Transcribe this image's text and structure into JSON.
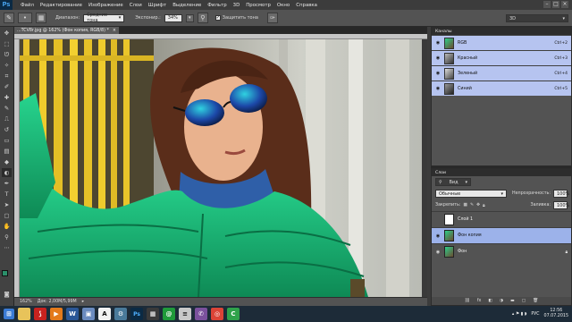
{
  "app": {
    "logo": "Ps"
  },
  "menu": [
    "Файл",
    "Редактирование",
    "Изображение",
    "Слои",
    "Шрифт",
    "Выделение",
    "Фильтр",
    "3D",
    "Просмотр",
    "Окно",
    "Справка"
  ],
  "options_bar": {
    "range_label": "Диапазон:",
    "range_value": "Средние тона",
    "exposure_label": "Экспонир.:",
    "exposure_value": "34%",
    "protect_label": "Защитить тона",
    "protect_checked": "✓",
    "workspace": "3D"
  },
  "document": {
    "tab_title": "...TCV8r.jpg @ 162% (Фон копия, RGB/8) *",
    "close": "×",
    "status_zoom": "162%",
    "status_doc": "Док: 2,00М/5,99М"
  },
  "colors": {
    "foreground": "#2b8f6a",
    "background": "#ffffff",
    "accent": "#b6c4f0"
  },
  "channels_panel": {
    "title": "Каналы",
    "channels": [
      {
        "name": "RGB",
        "shortcut": "Ctrl+2"
      },
      {
        "name": "Красный",
        "shortcut": "Ctrl+3"
      },
      {
        "name": "Зеленый",
        "shortcut": "Ctrl+4"
      },
      {
        "name": "Синий",
        "shortcut": "Ctrl+5"
      }
    ]
  },
  "layers_panel": {
    "title": "Слои",
    "kind_label": "Вид",
    "blend_mode": "Обычные",
    "opacity_label": "Непрозрачность:",
    "opacity_value": "100%",
    "lock_label": "Закрепить:",
    "fill_label": "Заливка:",
    "fill_value": "100%",
    "layers": [
      {
        "name": "Слой 1"
      },
      {
        "name": "Фон копия"
      },
      {
        "name": "Фон"
      }
    ]
  },
  "taskbar": {
    "language": "РУС",
    "time": "12:56",
    "date": "07.07.2015"
  }
}
